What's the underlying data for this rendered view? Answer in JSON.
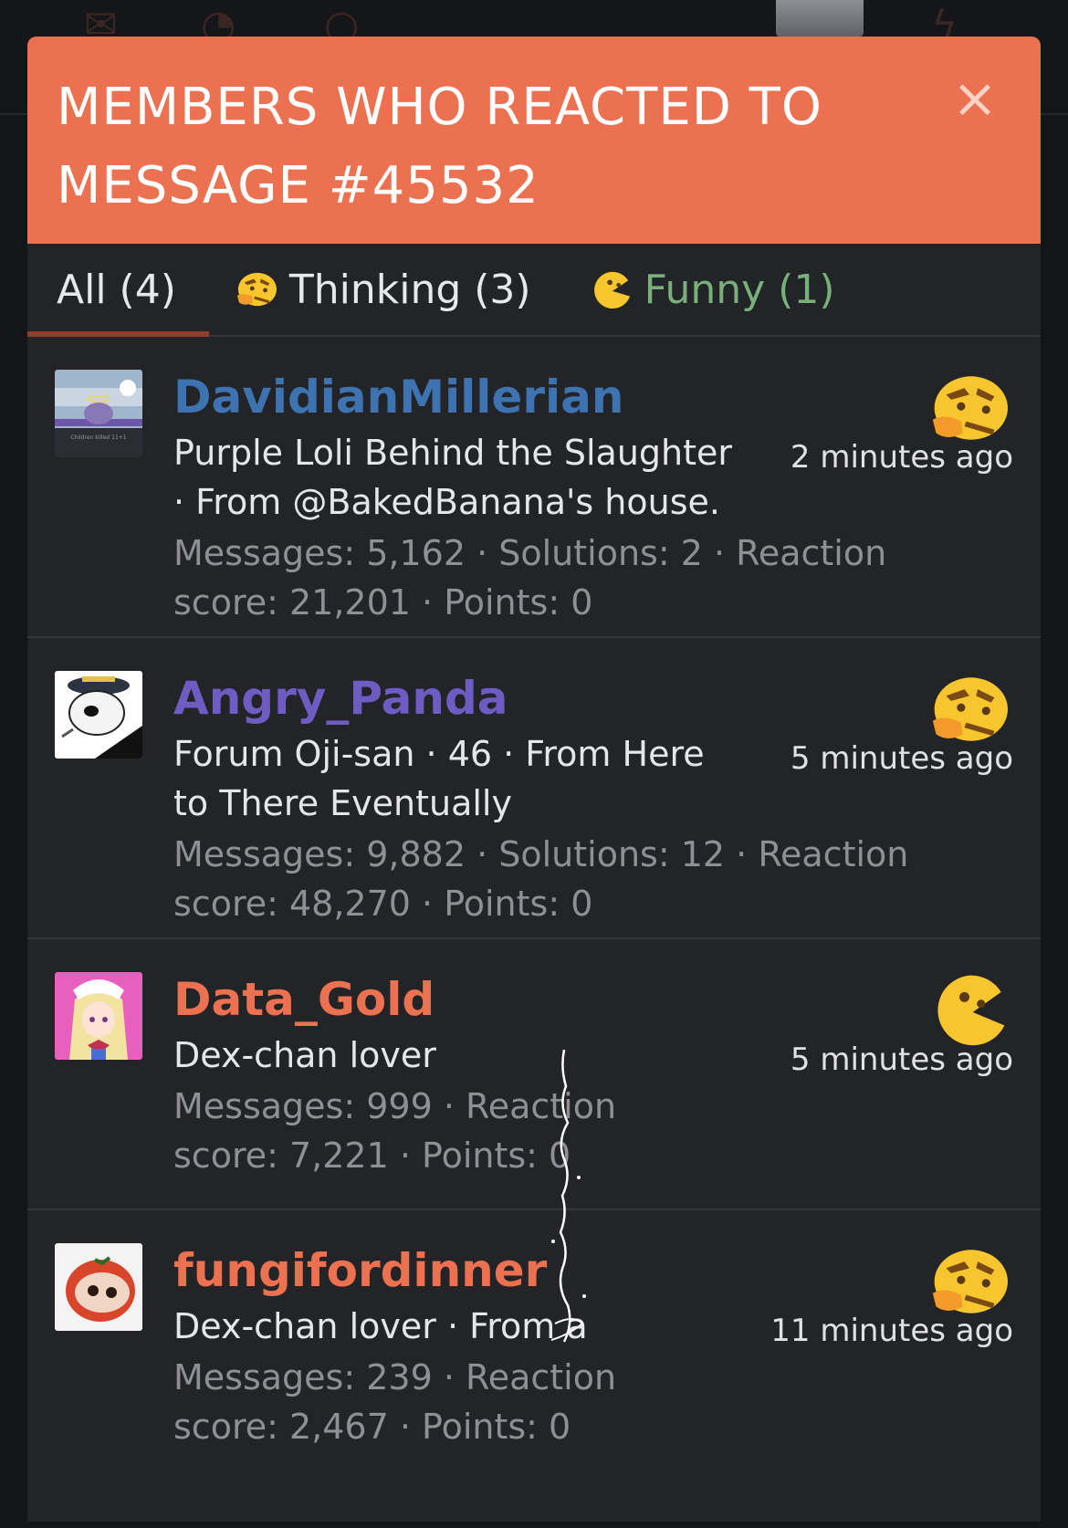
{
  "modal": {
    "title": "MEMBERS WHO REACTED TO MESSAGE #45532",
    "close_symbol": "×"
  },
  "tabs": [
    {
      "label": "All (4)",
      "active": true
    },
    {
      "label": "Thinking (3)",
      "icon": "thinking-emoji-icon"
    },
    {
      "label": "Funny (1)",
      "icon": "funny-emoji-icon",
      "color": "#78b07a"
    }
  ],
  "members": [
    {
      "name": "DavidianMillerian",
      "name_color": "#3c73b0",
      "title": "Purple Loli Behind the Slaughter · From @BakedBanana's house.",
      "stats": "Messages: 5,162 · Solutions: 2 · Reaction score: 21,201 · Points: 0",
      "reaction": "thinking-emoji-icon",
      "time": "2 minutes ago",
      "avatar_caption": "Children killed 11+1"
    },
    {
      "name": "Angry_Panda",
      "name_color": "#6f5cc3",
      "title": "Forum Oji-san · 46 · From Here to There Eventually",
      "stats": "Messages: 9,882 · Solutions: 12 · Reaction score: 48,270 · Points: 0",
      "reaction": "thinking-emoji-icon",
      "time": "5 minutes ago"
    },
    {
      "name": "Data_Gold",
      "name_color": "#ec7150",
      "title": "Dex-chan lover",
      "stats": "Messages: 999 · Reaction score: 7,221 · Points: 0",
      "reaction": "funny-emoji-icon",
      "time": "5 minutes ago"
    },
    {
      "name": "fungifordinner",
      "name_color": "#ec7150",
      "title": "Dex-chan lover · From a",
      "stats": "Messages: 239 · Reaction score: 2,467 · Points: 0",
      "reaction": "thinking-emoji-icon",
      "time": "11 minutes ago"
    }
  ],
  "colors": {
    "header": "#ec7150",
    "background": "#232428",
    "stats_text": "#8f9096"
  }
}
